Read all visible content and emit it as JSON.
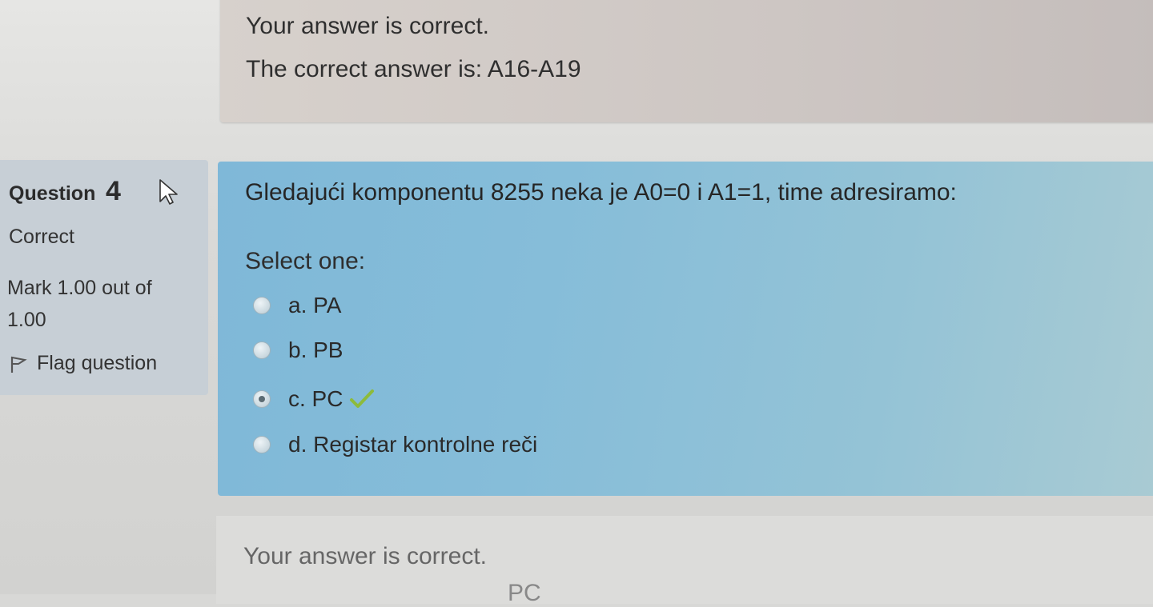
{
  "previous_feedback": {
    "line1": "Your answer is correct.",
    "line2": "The correct answer is: A16-A19"
  },
  "info": {
    "question_label": "Question",
    "question_number": "4",
    "state": "Correct",
    "grade": "Mark 1.00 out of 1.00",
    "flag_label": "Flag question"
  },
  "question": {
    "text": "Gledajući komponentu 8255 neka je A0=0 i A1=1, time adresiramo:",
    "prompt": "Select one:",
    "answers": [
      {
        "label": "a. PA",
        "selected": false
      },
      {
        "label": "b. PB",
        "selected": false
      },
      {
        "label": "c. PC",
        "selected": true,
        "correct": true
      },
      {
        "label": "d. Registar kontrolne reči",
        "selected": false
      }
    ]
  },
  "current_feedback": {
    "line1": "Your answer is correct.",
    "partial_text": "PC"
  },
  "colors": {
    "formulation_bg": "#86bdd9",
    "info_bg": "#c7cfd6",
    "feedback_bg": "#cdc6c3",
    "check_green": "#8dbb3b"
  },
  "icons": {
    "pointer": "mouse-pointer-icon",
    "flag": "flag-icon",
    "check": "check-icon"
  }
}
